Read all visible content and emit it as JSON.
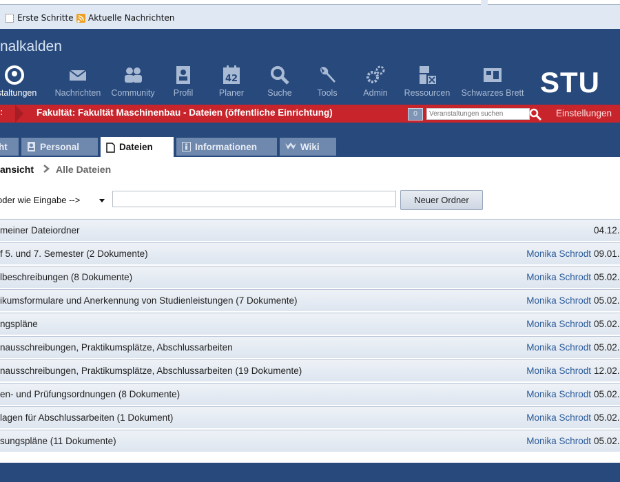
{
  "bookmarks": {
    "items": [
      {
        "label": "Erste Schritte"
      },
      {
        "label": "Aktuelle Nachrichten"
      }
    ]
  },
  "header": {
    "site_title": "nalkalden",
    "brand": "STU",
    "nav": [
      {
        "label": "nstaltungen",
        "icon": "courses-icon"
      },
      {
        "label": "Nachrichten",
        "icon": "mail-icon"
      },
      {
        "label": "Community",
        "icon": "community-icon"
      },
      {
        "label": "Profil",
        "icon": "profile-icon"
      },
      {
        "label": "Planer",
        "icon": "calendar-icon"
      },
      {
        "label": "Suche",
        "icon": "search-icon"
      },
      {
        "label": "Tools",
        "icon": "wrench-icon"
      },
      {
        "label": "Admin",
        "icon": "gears-icon"
      },
      {
        "label": "Ressourcen",
        "icon": "resources-icon"
      },
      {
        "label": "Schwarzes Brett",
        "icon": "board-icon"
      }
    ],
    "calendar_day": "42"
  },
  "context_bar": {
    "left_fragment": ":",
    "title": "Fakultät: Fakultät Maschinenbau - Dateien (öffentliche Einrichtung)",
    "badge": "0",
    "search_placeholder": "Veranstaltungen suchen",
    "settings": "Einstellungen",
    "bg_color": "#c8242b"
  },
  "tabs": [
    {
      "label": "ht",
      "active": false
    },
    {
      "label": "Personal",
      "active": false
    },
    {
      "label": "Dateien",
      "active": true
    },
    {
      "label": "Informationen",
      "active": false
    },
    {
      "label": "Wiki",
      "active": false
    }
  ],
  "breadcrumb": {
    "current": "ansicht",
    "sub": "Alle Dateien"
  },
  "controls": {
    "select_value": "oder wie Eingabe -->",
    "name_value": "",
    "new_folder_label": "Neuer Ordner"
  },
  "files": [
    {
      "name": "meiner Dateiordner",
      "author": "",
      "date": "04.12."
    },
    {
      "name": "f 5. und 7. Semester  (2 Dokumente)",
      "author": "Monika Schrodt",
      "date": "09.01."
    },
    {
      "name": "lbeschreibungen  (8 Dokumente)",
      "author": "Monika Schrodt",
      "date": "05.02."
    },
    {
      "name": "ikumsformulare und Anerkennung von Studienleistungen  (7 Dokumente)",
      "author": "Monika Schrodt",
      "date": "05.02."
    },
    {
      "name": "ngspläne",
      "author": "Monika Schrodt",
      "date": "05.02."
    },
    {
      "name": "nausschreibungen, Praktikumsplätze, Abschlussarbeiten",
      "author": "Monika Schrodt",
      "date": "05.02."
    },
    {
      "name": "nausschreibungen, Praktikumsplätze, Abschlussarbeiten  (19 Dokumente)",
      "author": "Monika Schrodt",
      "date": "12.02."
    },
    {
      "name": "en- und Prüfungsordnungen  (8 Dokumente)",
      "author": "Monika Schrodt",
      "date": "05.02."
    },
    {
      "name": "lagen für Abschlussarbeiten  (1 Dokument)",
      "author": "Monika Schrodt",
      "date": "05.02."
    },
    {
      "name": "sungspläne  (11 Dokumente)",
      "author": "Monika Schrodt",
      "date": "05.02."
    }
  ]
}
